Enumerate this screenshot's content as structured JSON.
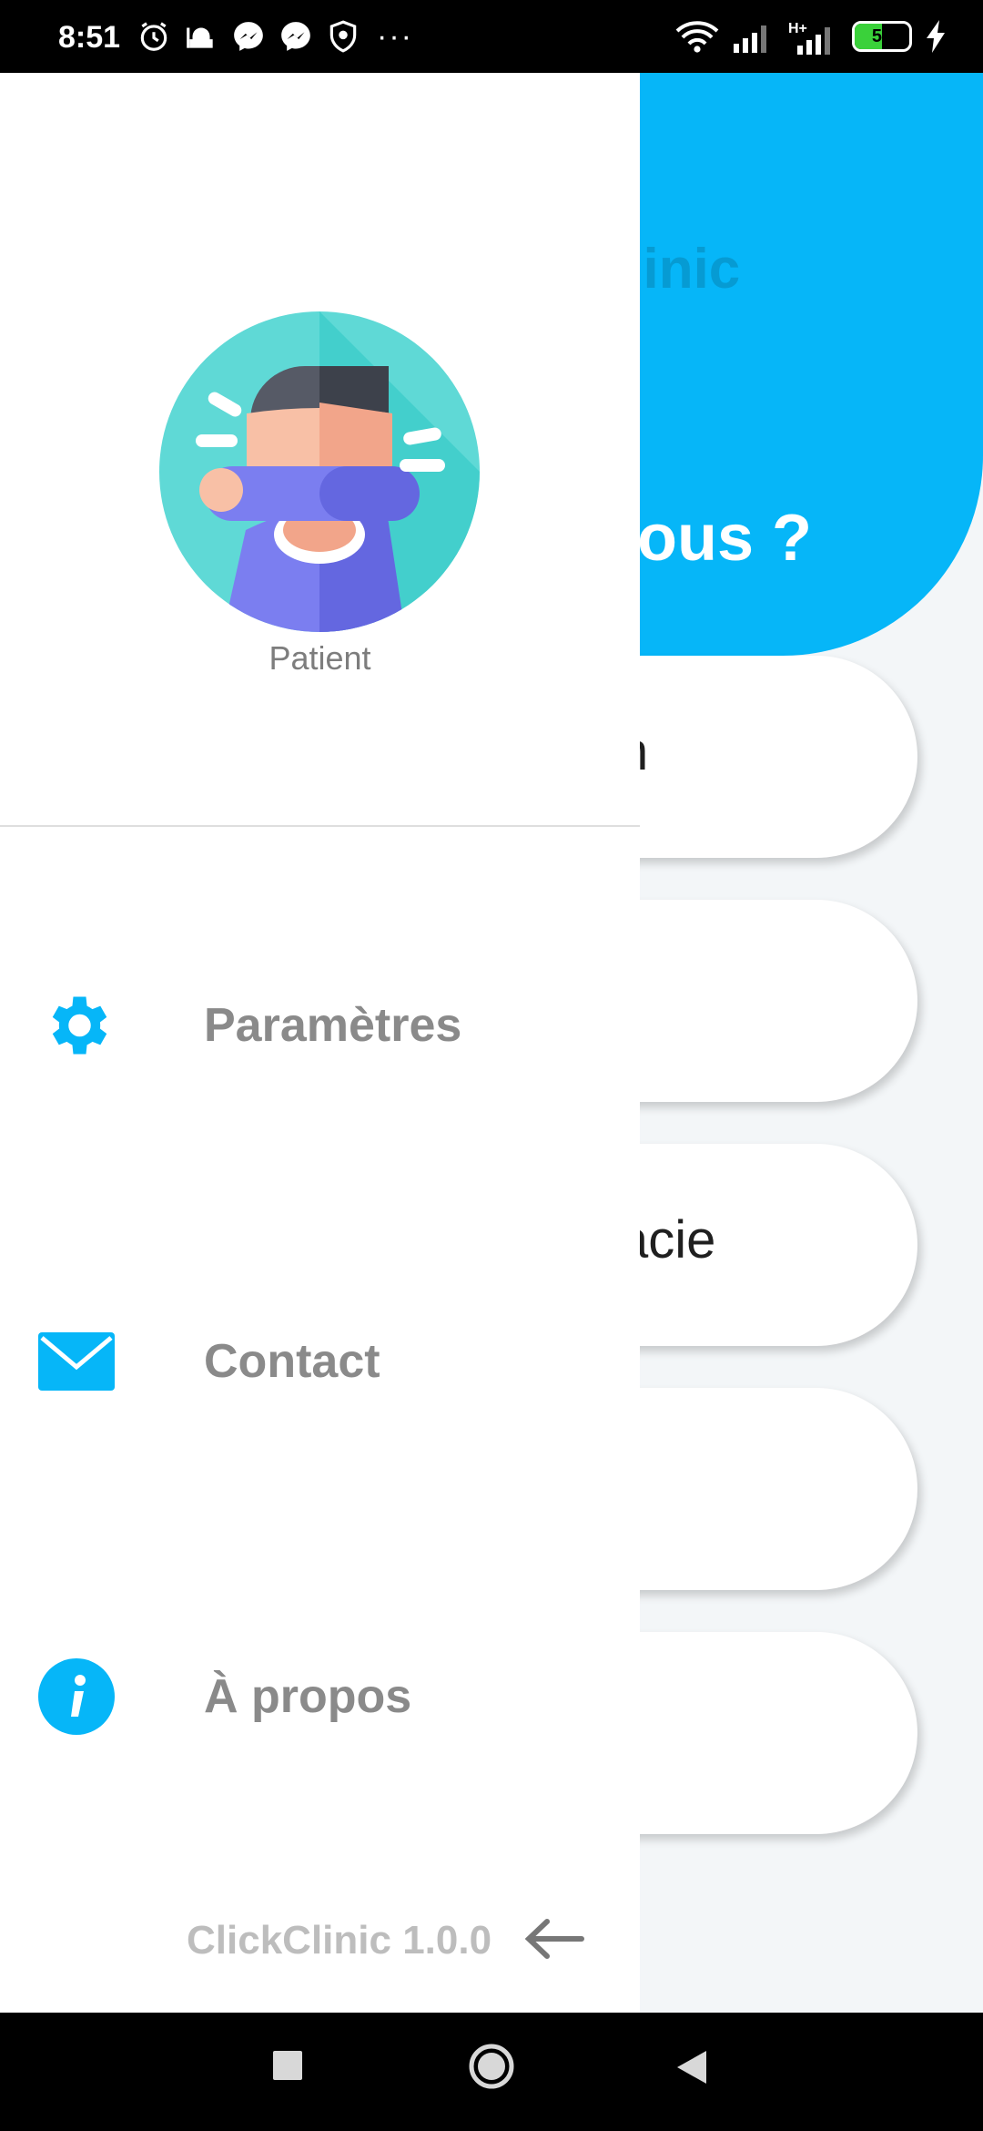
{
  "status_bar": {
    "time": "8:51",
    "battery_level": 50,
    "battery_label": "50",
    "network_label": "H+",
    "icons": [
      "alarm-icon",
      "mosque-icon",
      "messenger-icon",
      "messenger-icon",
      "shield-icon",
      "more-icon",
      "wifi-icon",
      "signal-icon",
      "signal-icon",
      "charging-icon"
    ],
    "more_dots": "···"
  },
  "background_app": {
    "title_fragment": "kClinic",
    "question_fragment": "vous ?",
    "pills": [
      "n",
      "",
      "acie",
      "",
      ""
    ],
    "accent_color": "#06b6f8"
  },
  "drawer": {
    "role": "Patient",
    "menu": [
      {
        "label": "Paramètres",
        "icon": "gear-icon"
      },
      {
        "label": "Contact",
        "icon": "mail-icon"
      },
      {
        "label": "À propos",
        "icon": "info-icon"
      }
    ],
    "version": "ClickClinic 1.0.0",
    "back_icon": "back-arrow-icon",
    "icon_color": "#06b6f8"
  },
  "nav_bar": {
    "buttons": [
      "recents-button",
      "home-button",
      "back-button"
    ]
  }
}
